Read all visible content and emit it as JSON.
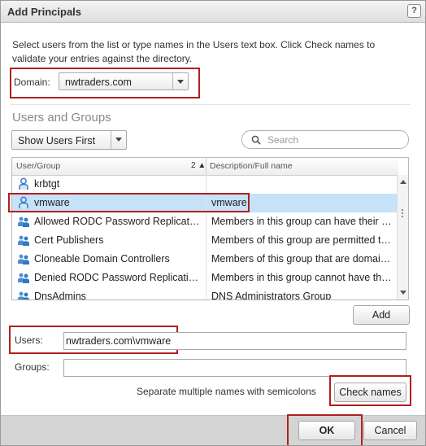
{
  "dialog": {
    "title": "Add Principals",
    "help": "?"
  },
  "intro": "Select users from the list or type names in the Users text box. Click Check names to validate your entries against the directory.",
  "domain": {
    "label": "Domain:",
    "value": "nwtraders.com"
  },
  "users_and_groups": {
    "title": "Users and Groups",
    "filter_value": "Show Users First",
    "search_placeholder": "Search"
  },
  "grid": {
    "col_user": "User/Group",
    "sort_indicator": "2 ▲",
    "col_desc": "Description/Full name",
    "rows": [
      {
        "name": "krbtgt",
        "description": "",
        "icon": "user-icon"
      },
      {
        "name": "vmware",
        "description": "vmware",
        "icon": "user-icon"
      },
      {
        "name": "Allowed RODC Password Replication Group",
        "description": "Members in this group can have their passwords replicated",
        "icon": "group-icon"
      },
      {
        "name": "Cert Publishers",
        "description": "Members of this group are permitted to publish certificates",
        "icon": "group-icon"
      },
      {
        "name": "Cloneable Domain Controllers",
        "description": "Members of this group that are domain controllers",
        "icon": "group-icon"
      },
      {
        "name": "Denied RODC Password Replication Group",
        "description": "Members in this group cannot have their passwords replicated",
        "icon": "group-icon"
      },
      {
        "name": "DnsAdmins",
        "description": "DNS Administrators Group",
        "icon": "group-icon"
      }
    ]
  },
  "add_button": "Add",
  "users": {
    "label": "Users:",
    "value": "nwtraders.com\\vmware"
  },
  "groups": {
    "label": "Groups:",
    "value": ""
  },
  "hint": "Separate multiple names with semicolons",
  "check_names_button": "Check names",
  "footer": {
    "ok": "OK",
    "cancel": "Cancel"
  },
  "colors": {
    "highlight": "#b21f1f",
    "selection": "#c5e2f8",
    "icon_blue": "#2f78c4"
  }
}
